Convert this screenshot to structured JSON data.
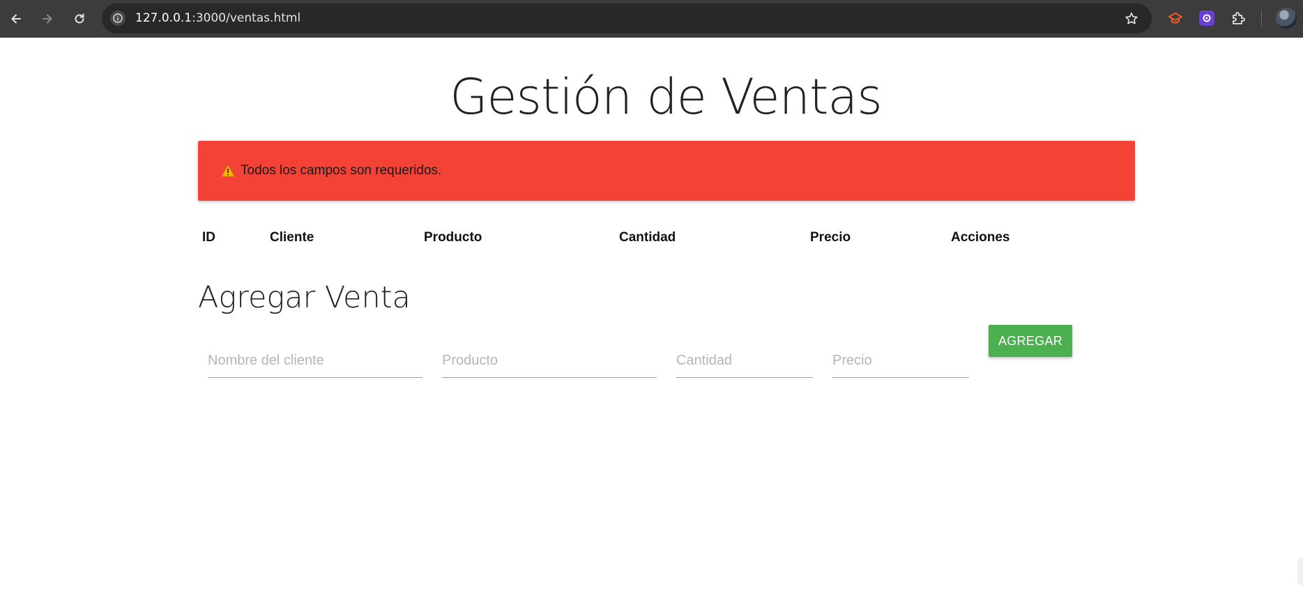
{
  "browser": {
    "url_host": "127.0.0.1",
    "url_path": ":3000/ventas.html"
  },
  "page": {
    "title": "Gestión de Ventas",
    "alert_message": "Todos los campos son requeridos.",
    "alert_color": "#f44336"
  },
  "table": {
    "columns": [
      "ID",
      "Cliente",
      "Producto",
      "Cantidad",
      "Precio",
      "Acciones"
    ]
  },
  "form": {
    "title": "Agregar Venta",
    "client_placeholder": "Nombre del cliente",
    "product_placeholder": "Producto",
    "quantity_placeholder": "Cantidad",
    "price_placeholder": "Precio",
    "submit_label": "AGREGAR",
    "submit_color": "#4caf50"
  },
  "icons": [
    "back-icon",
    "forward-icon",
    "reload-icon",
    "info-icon",
    "star-icon",
    "graduation-cap-icon",
    "settings-icon",
    "puzzle-icon",
    "avatar",
    "warning-icon"
  ]
}
